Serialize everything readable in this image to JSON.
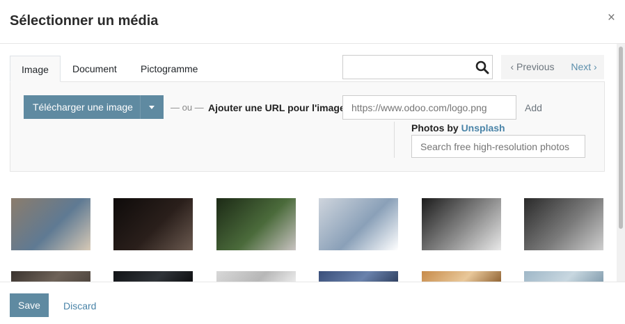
{
  "dialog": {
    "title": "Sélectionner un média",
    "close_icon": "close-icon"
  },
  "tabs": [
    {
      "label": "Image",
      "active": true
    },
    {
      "label": "Document",
      "active": false
    },
    {
      "label": "Pictogramme",
      "active": false
    }
  ],
  "search": {
    "value": "",
    "placeholder": "",
    "icon": "search-icon"
  },
  "pager": {
    "previous_label": "‹ Previous",
    "next_label": "Next ›"
  },
  "upload": {
    "button_label": "Télécharger une image",
    "dropdown_icon": "caret-down-icon",
    "or_text": "— ou —"
  },
  "url": {
    "label": "Ajouter une URL pour l'image",
    "placeholder": "https://www.odoo.com/logo.png",
    "value": "",
    "add_label": "Add"
  },
  "unsplash": {
    "prefix": "Photos by ",
    "link_label": "Unsplash",
    "search_placeholder": "Search free high-resolution photos"
  },
  "images": [
    {
      "name": "thumbnail-office-desks",
      "colors": [
        "#8b7c6c",
        "#5f7a93",
        "#d7c9b6"
      ]
    },
    {
      "name": "thumbnail-hands-dark",
      "colors": [
        "#0e0b0a",
        "#2a1f1b",
        "#6b5a50"
      ]
    },
    {
      "name": "thumbnail-mailbox",
      "colors": [
        "#1c2a16",
        "#4b6b3b",
        "#c9c3c2"
      ]
    },
    {
      "name": "thumbnail-sail",
      "colors": [
        "#cfd5dd",
        "#8aa0b8",
        "#ffffff"
      ]
    },
    {
      "name": "thumbnail-skyscrapers",
      "colors": [
        "#1c1c1c",
        "#8a8a8a",
        "#e9e9e9"
      ]
    },
    {
      "name": "thumbnail-crowd-bw",
      "colors": [
        "#2a2a2a",
        "#7a7a7a",
        "#cfcfcf"
      ]
    },
    {
      "name": "thumbnail-row2-1",
      "colors": [
        "#3b342f",
        "#6e6258",
        "#4d443d"
      ]
    },
    {
      "name": "thumbnail-row2-2",
      "colors": [
        "#121417",
        "#2f3338",
        "#0b0c0e"
      ]
    },
    {
      "name": "thumbnail-row2-3",
      "colors": [
        "#d8d8d8",
        "#b7b7b7",
        "#efefef"
      ]
    },
    {
      "name": "thumbnail-row2-4",
      "colors": [
        "#3a4f7a",
        "#6a82ac",
        "#2b3c5c"
      ]
    },
    {
      "name": "thumbnail-row2-5",
      "colors": [
        "#c78b4a",
        "#e9c89a",
        "#8a5c2c"
      ]
    },
    {
      "name": "thumbnail-row2-6",
      "colors": [
        "#9fb7c7",
        "#c8d7e0",
        "#7f9aab"
      ]
    }
  ],
  "footer": {
    "save_label": "Save",
    "discard_label": "Discard"
  },
  "colors": {
    "primary": "#5f8aa1",
    "link": "#4a84a8"
  }
}
